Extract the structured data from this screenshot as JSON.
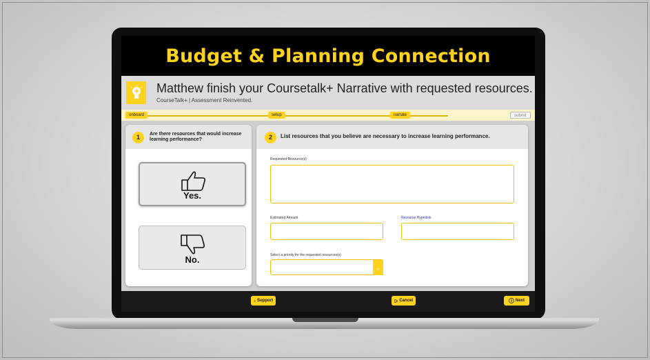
{
  "app": {
    "title": "Budget & Planning Connection",
    "headline": "Matthew finish your Coursetalk+ Narrative with requested resources.",
    "tagline": "CourseTalk+ | Assessment Reinvented."
  },
  "progress": {
    "steps": [
      {
        "label": "onboard",
        "state": "done"
      },
      {
        "label": "setup",
        "state": "done"
      },
      {
        "label": "narrate",
        "state": "done"
      },
      {
        "label": "submit",
        "state": "todo"
      }
    ]
  },
  "question1": {
    "number": "1",
    "text": "Are there resources that would increase learning performance?",
    "options": [
      {
        "label": "Yes.",
        "icon": "thumbs-up-icon",
        "selected": true
      },
      {
        "label": "No.",
        "icon": "thumbs-down-icon",
        "selected": false
      }
    ]
  },
  "question2": {
    "number": "2",
    "text": "List resources that you believe are necessary to increase learning performance.",
    "fields": {
      "requested_label": "Requested Resource(s)",
      "requested_value": "",
      "amount_label": "Estimated Amount",
      "amount_value": "",
      "hyperlink_label": "Resourse Hyperlink",
      "hyperlink_value": "",
      "priority_label": "Select a priority for the requested resources(s)",
      "priority_value": ""
    }
  },
  "footer": {
    "support_label": "Support",
    "cancel_label": "Cancel",
    "next_label": "Next"
  },
  "colors": {
    "accent": "#ffd21f",
    "header_bg": "#000000",
    "link": "#2233aa"
  }
}
